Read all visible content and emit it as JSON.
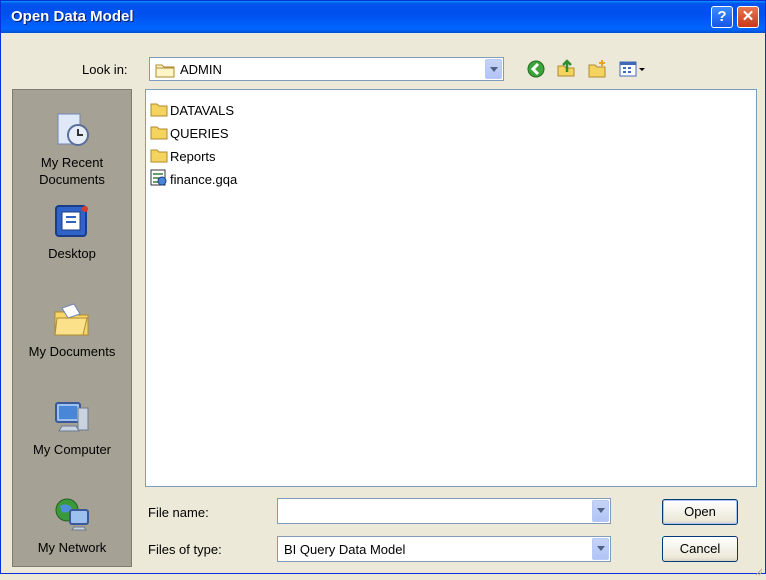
{
  "window": {
    "title": "Open Data Model"
  },
  "titlebar": {
    "help_label": "?",
    "close_label": "✕"
  },
  "toolbar": {
    "look_in_label": "Look in:",
    "look_in_value": "ADMIN"
  },
  "places": [
    {
      "label": "My Recent\nDocuments",
      "icon": "recent-documents-icon"
    },
    {
      "label": "Desktop",
      "icon": "desktop-icon"
    },
    {
      "label": "My Documents",
      "icon": "my-documents-icon"
    },
    {
      "label": "My Computer",
      "icon": "my-computer-icon"
    },
    {
      "label": "My Network",
      "icon": "my-network-icon"
    }
  ],
  "files": [
    {
      "name": "DATAVALS",
      "type": "folder"
    },
    {
      "name": "QUERIES",
      "type": "folder"
    },
    {
      "name": "Reports",
      "type": "folder"
    },
    {
      "name": "finance.gqa",
      "type": "file"
    }
  ],
  "form": {
    "filename_label": "File name:",
    "filename_value": "",
    "filetype_label": "Files of type:",
    "filetype_value": "BI Query Data Model"
  },
  "buttons": {
    "open": "Open",
    "cancel": "Cancel"
  },
  "colors": {
    "title_bar": "#0054e3",
    "dialog_bg": "#ece9d8",
    "places_bar": "#a5a194"
  }
}
